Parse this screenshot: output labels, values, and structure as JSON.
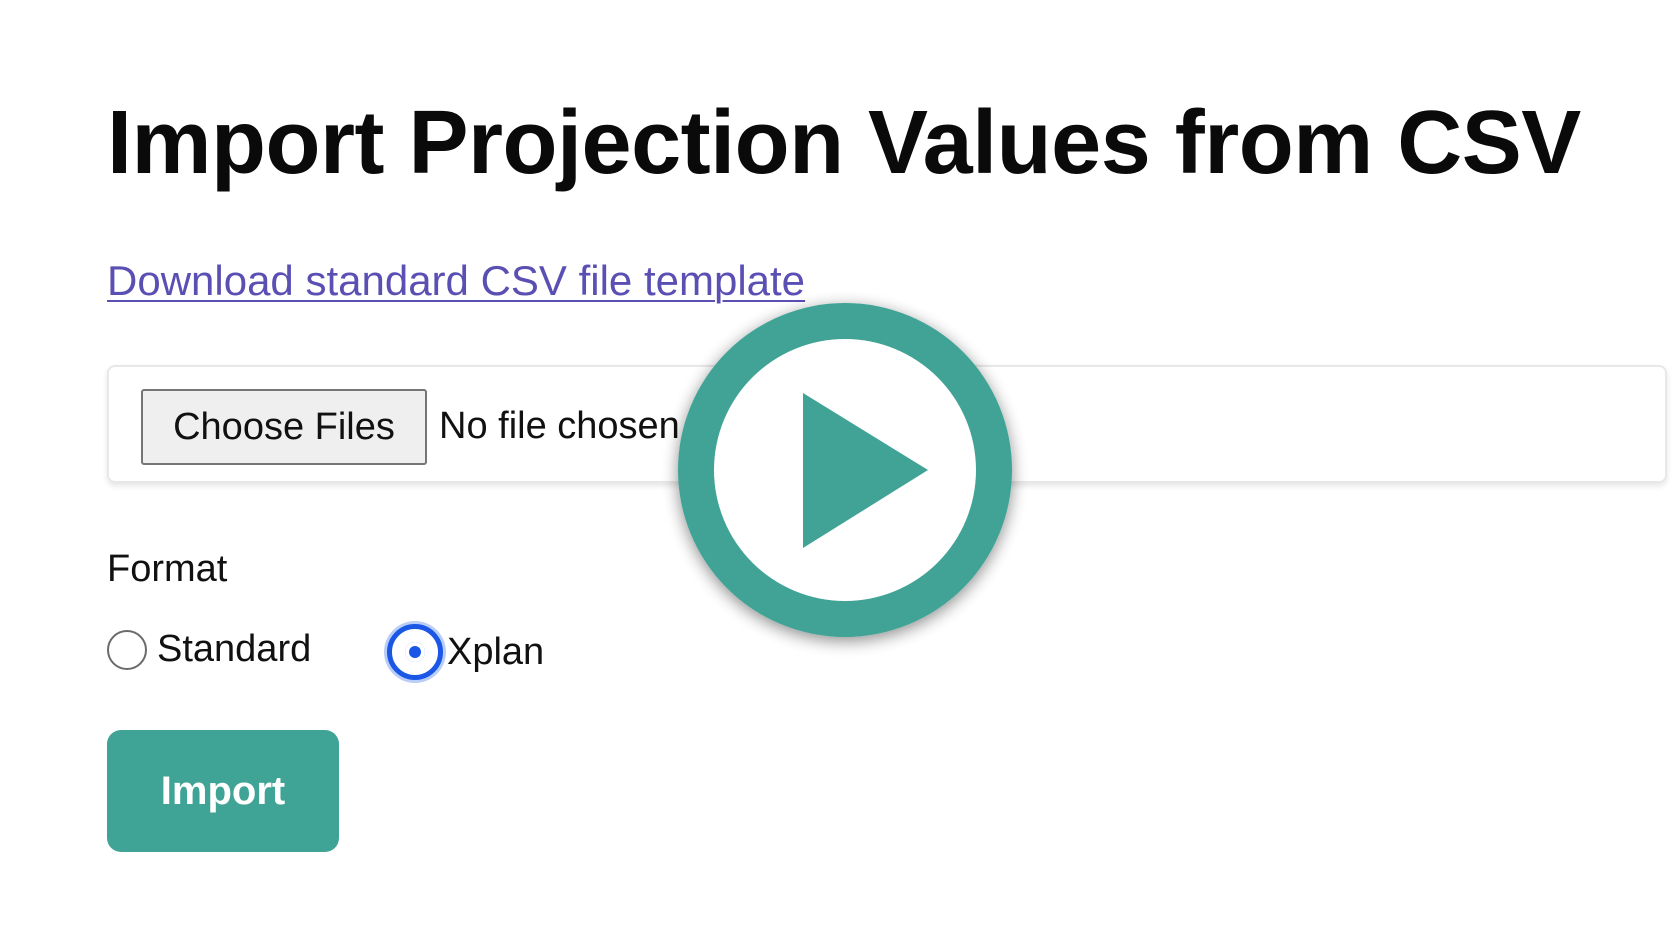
{
  "page": {
    "title": "Import Projection Values from CSV",
    "template_link": "Download standard CSV file template"
  },
  "file_input": {
    "button_label": "Choose Files",
    "status": "No file chosen"
  },
  "format": {
    "label": "Format",
    "options": [
      {
        "label": "Standard",
        "selected": false
      },
      {
        "label": "Xplan",
        "selected": true
      }
    ]
  },
  "actions": {
    "import_label": "Import"
  },
  "overlay": {
    "icon": "play-icon",
    "accent_color": "#3fa396"
  },
  "colors": {
    "link": "#5a4fb3",
    "radio_selected": "#1a57e6",
    "primary_button": "#3fa396"
  }
}
